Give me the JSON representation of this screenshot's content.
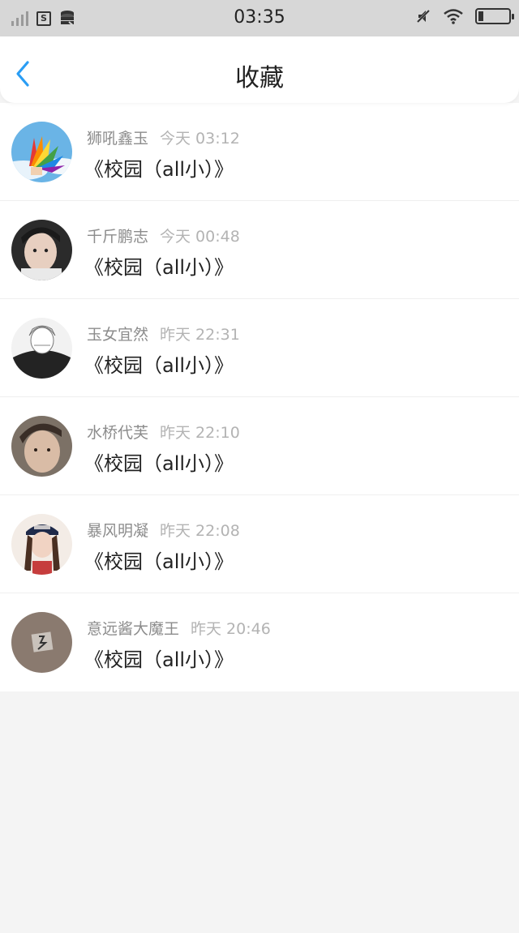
{
  "status_bar": {
    "sim_icon_label": "S",
    "time": "03:35"
  },
  "nav": {
    "title": "收藏"
  },
  "items": [
    {
      "name": "狮吼鑫玉",
      "time": "今天 03:12",
      "title": "《校园（all小）》"
    },
    {
      "name": "千斤鹏志",
      "time": "今天 00:48",
      "title": "《校园（all小）》"
    },
    {
      "name": "玉女宜然",
      "time": "昨天 22:31",
      "title": "《校园（all小）》"
    },
    {
      "name": "水桥代芙",
      "time": "昨天 22:10",
      "title": "《校园（all小）》"
    },
    {
      "name": "暴风明凝",
      "time": "昨天 22:08",
      "title": "《校园（all小）》"
    },
    {
      "name": "意远酱大魔王",
      "time": "昨天 20:46",
      "title": "《校园（all小）》"
    }
  ],
  "colors": {
    "accent": "#2a9df4",
    "status_bar_bg": "#d7d7d7",
    "page_bg": "#f4f4f4"
  }
}
